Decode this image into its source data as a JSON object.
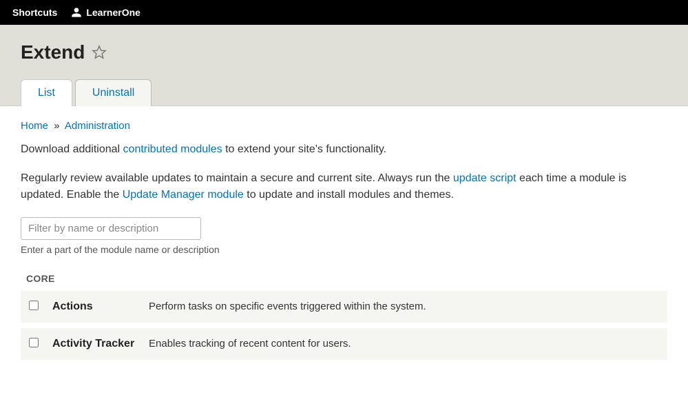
{
  "toolbar": {
    "shortcuts_label": "Shortcuts",
    "user_label": "LearnerOne"
  },
  "page_title": "Extend",
  "tabs": {
    "list": "List",
    "uninstall": "Uninstall"
  },
  "breadcrumb": {
    "home": "Home",
    "admin": "Administration"
  },
  "intro": {
    "prefix": "Download additional ",
    "link": "contributed modules",
    "suffix": " to extend your site's functionality."
  },
  "intro2": {
    "p1": "Regularly review available updates to maintain a secure and current site. Always run the ",
    "link1": "update script",
    "p2": " each time a module is updated. Enable the ",
    "link2": "Update Manager module",
    "p3": " to update and install modules and themes."
  },
  "filter": {
    "placeholder": "Filter by name or description",
    "hint": "Enter a part of the module name or description"
  },
  "section_header": "CORE",
  "modules": [
    {
      "name": "Actions",
      "desc": "Perform tasks on specific events triggered within the system."
    },
    {
      "name": "Activity Tracker",
      "desc": "Enables tracking of recent content for users."
    }
  ]
}
